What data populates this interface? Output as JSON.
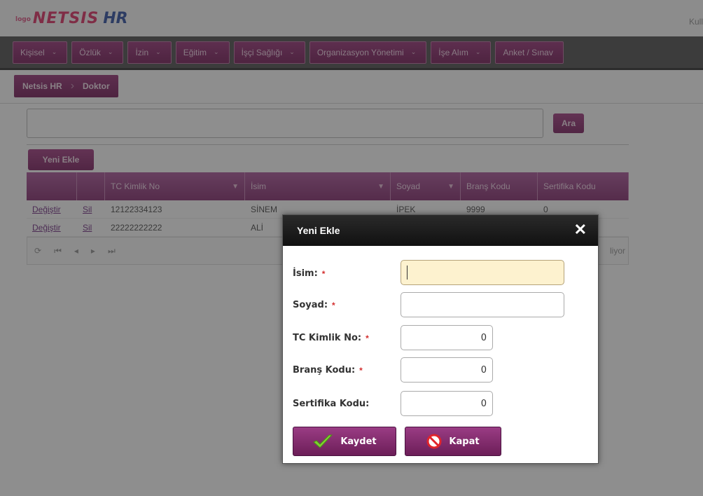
{
  "header": {
    "logo_small": "logo",
    "logo_main": "NETSIS",
    "logo_hr": "HR",
    "user_link": "Kull"
  },
  "menu": [
    {
      "label": "Kişisel"
    },
    {
      "label": "Özlük"
    },
    {
      "label": "İzin"
    },
    {
      "label": "Eğitim"
    },
    {
      "label": "İşçi Sağlığı"
    },
    {
      "label": "Organizasyon Yönetimi"
    },
    {
      "label": "İşe Alım"
    },
    {
      "label": "Anket / Sınav"
    }
  ],
  "breadcrumb": [
    "Netsis HR",
    "Doktor"
  ],
  "search": {
    "value": "",
    "button_label": "Ara"
  },
  "toolbar": {
    "add_label": "Yeni Ekle"
  },
  "grid": {
    "columns": [
      "TC Kimlik No",
      "İsim",
      "Soyad",
      "Branş Kodu",
      "Sertifika Kodu"
    ],
    "rows": [
      {
        "edit": "Değiştir",
        "delete": "Sil",
        "tc": "12122334123",
        "name": "SİNEM",
        "surname": "İPEK",
        "brans": "9999",
        "sertifika": "0"
      },
      {
        "edit": "Değiştir",
        "delete": "Sil",
        "tc": "22222222222",
        "name": "ALİ",
        "surname": "",
        "brans": "",
        "sertifika": ""
      }
    ],
    "footer_info": "liyor"
  },
  "dialog": {
    "title": "Yeni Ekle",
    "fields": [
      {
        "label": "İsim:",
        "required": "*",
        "value": ""
      },
      {
        "label": "Soyad:",
        "required": "*",
        "value": ""
      },
      {
        "label": "TC Kimlik No:",
        "required": "*",
        "value": "0"
      },
      {
        "label": "Branş Kodu:",
        "required": "*",
        "value": "0"
      },
      {
        "label": "Sertifika Kodu:",
        "required": "",
        "value": "0"
      }
    ],
    "save_label": "Kaydet",
    "close_label": "Kapat"
  },
  "colors": {
    "accent": "#8c3a78",
    "required": "#d32f2f",
    "active_field": "#fdf2cf"
  }
}
